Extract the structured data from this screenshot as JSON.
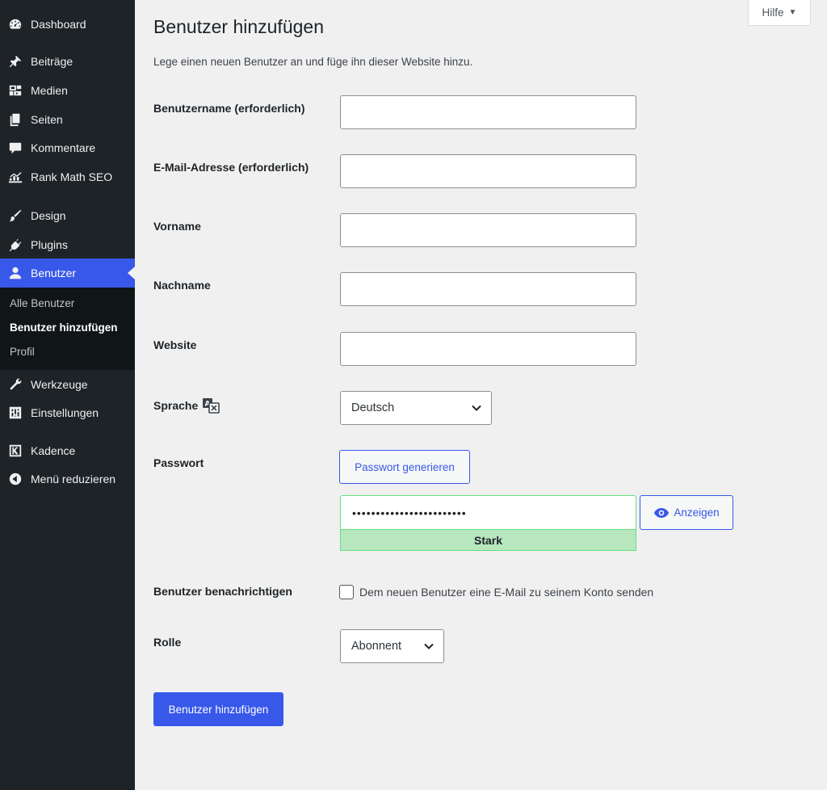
{
  "sidebar": {
    "items": [
      {
        "label": "Dashboard",
        "icon": "dashboard-icon"
      },
      {
        "label": "Beiträge",
        "icon": "pin-icon"
      },
      {
        "label": "Medien",
        "icon": "media-icon"
      },
      {
        "label": "Seiten",
        "icon": "pages-icon"
      },
      {
        "label": "Kommentare",
        "icon": "comment-icon"
      },
      {
        "label": "Rank Math SEO",
        "icon": "rank-math-icon"
      },
      {
        "label": "Design",
        "icon": "brush-icon"
      },
      {
        "label": "Plugins",
        "icon": "plugin-icon"
      },
      {
        "label": "Benutzer",
        "icon": "user-icon"
      },
      {
        "label": "Werkzeuge",
        "icon": "wrench-icon"
      },
      {
        "label": "Einstellungen",
        "icon": "settings-icon"
      },
      {
        "label": "Kadence",
        "icon": "kadence-icon"
      },
      {
        "label": "Menü reduzieren",
        "icon": "collapse-icon"
      }
    ],
    "submenu": [
      "Alle Benutzer",
      "Benutzer hinzufügen",
      "Profil"
    ]
  },
  "help": {
    "label": "Hilfe",
    "caret": "▼"
  },
  "page": {
    "title": "Benutzer hinzufügen",
    "description": "Lege einen neuen Benutzer an und füge ihn dieser Website hinzu."
  },
  "form": {
    "username_label": "Benutzername (erforderlich)",
    "email_label": "E-Mail-Adresse (erforderlich)",
    "firstname_label": "Vorname",
    "lastname_label": "Nachname",
    "website_label": "Website",
    "language_label": "Sprache",
    "language_value": "Deutsch",
    "password_label": "Passwort",
    "generate_password": "Passwort generieren",
    "password_mask": "••••••••••••••••••••••••",
    "show_password": "Anzeigen",
    "strength": "Stark",
    "notify_label": "Benutzer benachrichtigen",
    "notify_text": "Dem neuen Benutzer eine E-Mail zu seinem Konto senden",
    "role_label": "Rolle",
    "role_value": "Abonnent",
    "submit": "Benutzer hinzufügen"
  },
  "colors": {
    "accent": "#3858e9",
    "sidebar": "#1d2327",
    "strength_bg": "#b8e6bf"
  }
}
